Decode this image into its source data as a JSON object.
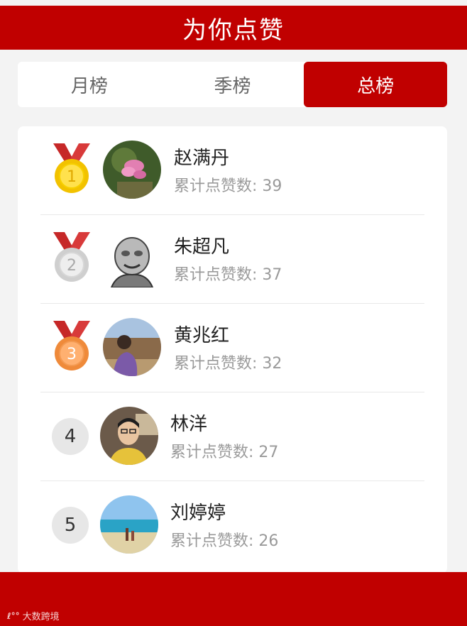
{
  "header": {
    "title": "为你点赞"
  },
  "tabs": [
    {
      "label": "月榜",
      "active": false
    },
    {
      "label": "季榜",
      "active": false
    },
    {
      "label": "总榜",
      "active": true
    }
  ],
  "ranking": [
    {
      "rank": "1",
      "badge": "gold-medal-icon",
      "name": "赵满丹",
      "likes": "累计点赞数: 39",
      "avatar": "flower-photo"
    },
    {
      "rank": "2",
      "badge": "silver-medal-icon",
      "name": "朱超凡",
      "likes": "累计点赞数: 37",
      "avatar": "sketch-portrait"
    },
    {
      "rank": "3",
      "badge": "bronze-medal-icon",
      "name": "黄兆红",
      "likes": "累计点赞数: 32",
      "avatar": "outdoor-photo"
    },
    {
      "rank": "4",
      "badge": "rank-circle",
      "name": "林洋",
      "likes": "累计点赞数: 27",
      "avatar": "portrait-photo"
    },
    {
      "rank": "5",
      "badge": "rank-circle",
      "name": "刘婷婷",
      "likes": "累计点赞数: 26",
      "avatar": "beach-photo"
    }
  ],
  "watermark": {
    "logo": "ℓ°°",
    "text": "大数跨境"
  },
  "colors": {
    "brand_red": "#c00000",
    "gold": "#f2c200",
    "silver": "#c9c9c9",
    "bronze": "#ef8a3a",
    "ribbon": "#c62828"
  }
}
